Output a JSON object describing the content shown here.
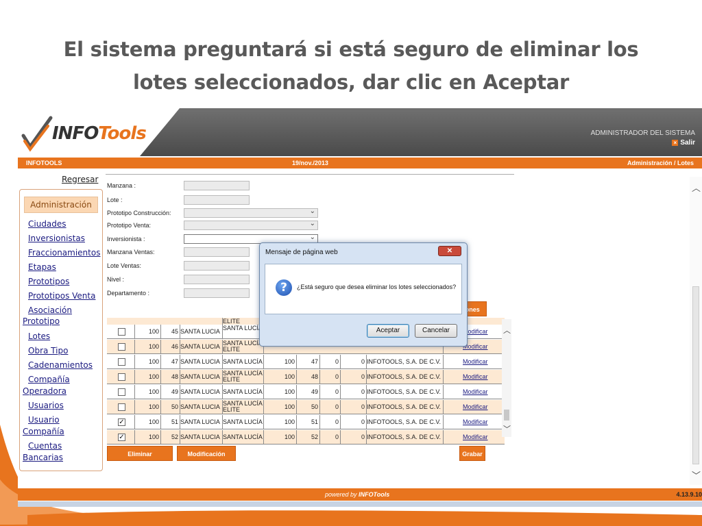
{
  "slide": {
    "title_line1": "El sistema preguntará si está seguro de eliminar los",
    "title_line2": "lotes seleccionados, dar clic en Aceptar"
  },
  "app": {
    "logo_prefix": "INFO",
    "logo_suffix": "Tools",
    "admin_label": "ADMINISTRADOR DEL SISTEMA",
    "salir": "Salir",
    "topbar_left": "INFOTOOLS",
    "topbar_date": "19/nov./2013",
    "topbar_right": "Administración / Lotes",
    "footer_powered": "powered by",
    "footer_logo": "INFOTools",
    "version": "4.13.9.10",
    "colors": {
      "accent": "#e8741e",
      "link": "#1a1a80"
    }
  },
  "sidebar": {
    "regresar": "Regresar",
    "header": "Administración",
    "items": [
      "Ciudades",
      "Inversionistas",
      "Fraccionamientos",
      "Etapas",
      "Prototipos",
      "Prototipos Venta",
      "Asociación",
      "Prototipo",
      "Lotes",
      "Obra Tipo",
      "Cadenamientos",
      "Compañía",
      "Operadora",
      "Usuarios",
      "Usuario",
      "Compañía",
      "Cuentas",
      "Bancarias"
    ]
  },
  "form": {
    "labels": [
      "Manzana :",
      "Lote :",
      "Prototipo Construcción:",
      "Prototipo Venta:",
      "Inversionista :",
      "Manzana Ventas:",
      "Lote Ventas:",
      "Nivel :",
      "Departamento :"
    ],
    "partial_button": "iones"
  },
  "table": {
    "partial_top": "ELITE",
    "rows": [
      {
        "checked": false,
        "c1": "100",
        "c2": "45",
        "fracc": "SANTA LUCIA",
        "proto1": "SANTA LUCÍA",
        "proto2": "",
        "c5": "",
        "c6": "",
        "c7": "",
        "c8": "",
        "empresa": "",
        "action": "Modificar"
      },
      {
        "checked": false,
        "c1": "100",
        "c2": "46",
        "fracc": "SANTA LUCIA",
        "proto1": "SANTA LUCÍA",
        "proto2": "ELITE",
        "c5": "",
        "c6": "",
        "c7": "",
        "c8": "",
        "empresa": "",
        "action": "Modificar"
      },
      {
        "checked": false,
        "c1": "100",
        "c2": "47",
        "fracc": "SANTA LUCIA",
        "proto1": "SANTA LUCÍA",
        "proto2": "",
        "c5": "100",
        "c6": "47",
        "c7": "0",
        "c8": "0",
        "empresa": "INFOTOOLS, S.A. DE C.V.",
        "action": "Modificar"
      },
      {
        "checked": false,
        "c1": "100",
        "c2": "48",
        "fracc": "SANTA LUCIA",
        "proto1": "SANTA LUCÍA",
        "proto2": "ELITE",
        "c5": "100",
        "c6": "48",
        "c7": "0",
        "c8": "0",
        "empresa": "INFOTOOLS, S.A. DE C.V.",
        "action": "Modificar"
      },
      {
        "checked": false,
        "c1": "100",
        "c2": "49",
        "fracc": "SANTA LUCIA",
        "proto1": "SANTA LUCÍA",
        "proto2": "",
        "c5": "100",
        "c6": "49",
        "c7": "0",
        "c8": "0",
        "empresa": "INFOTOOLS, S.A. DE C.V.",
        "action": "Modificar"
      },
      {
        "checked": false,
        "c1": "100",
        "c2": "50",
        "fracc": "SANTA LUCIA",
        "proto1": "SANTA LUCÍA",
        "proto2": "ELITE",
        "c5": "100",
        "c6": "50",
        "c7": "0",
        "c8": "0",
        "empresa": "INFOTOOLS, S.A. DE C.V.",
        "action": "Modificar"
      },
      {
        "checked": true,
        "c1": "100",
        "c2": "51",
        "fracc": "SANTA LUCIA",
        "proto1": "SANTA LUCÍA",
        "proto2": "",
        "c5": "100",
        "c6": "51",
        "c7": "0",
        "c8": "0",
        "empresa": "INFOTOOLS, S.A. DE C.V.",
        "action": "Modificar"
      },
      {
        "checked": true,
        "c1": "100",
        "c2": "52",
        "fracc": "SANTA LUCIA",
        "proto1": "SANTA LUCÍA",
        "proto2": "",
        "c5": "100",
        "c6": "52",
        "c7": "0",
        "c8": "0",
        "empresa": "INFOTOOLS, S.A. DE C.V.",
        "action": "Modificar"
      }
    ]
  },
  "buttons": {
    "eliminar": "Eliminar Seleccionados",
    "masiva": "Modificación Masiva",
    "grabar": "Grabar"
  },
  "dialog": {
    "title": "Mensaje de página web",
    "message": "¿Está seguro que desea eliminar los lotes seleccionados?",
    "ok": "Aceptar",
    "cancel": "Cancelar",
    "icon": "question-icon"
  }
}
